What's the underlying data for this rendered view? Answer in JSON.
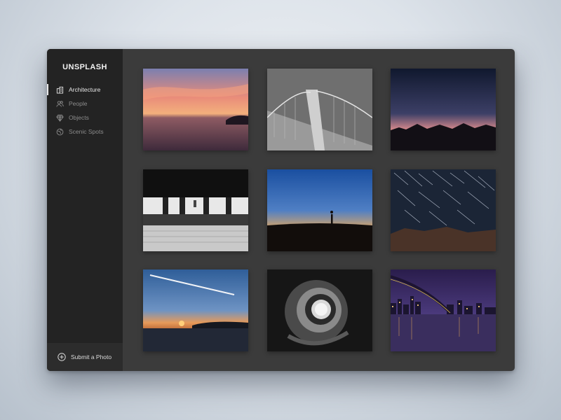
{
  "app": {
    "brand": "UNSPLASH"
  },
  "sidebar": {
    "items": [
      {
        "label": "Architecture",
        "icon": "building-icon",
        "active": true
      },
      {
        "label": "People",
        "icon": "people-icon",
        "active": false
      },
      {
        "label": "Objects",
        "icon": "diamond-icon",
        "active": false
      },
      {
        "label": "Scenic Spots",
        "icon": "globe-icon",
        "active": false
      }
    ],
    "submit_label": "Submit a Photo",
    "submit_icon": "plus-circle-icon"
  },
  "gallery": {
    "photos": [
      "sunset-sea-photo",
      "bridge-tower-photo",
      "mountain-dusk-photo",
      "subway-station-photo",
      "silhouette-horizon-photo",
      "star-trails-photo",
      "contrail-sunset-photo",
      "spiral-staircase-photo",
      "city-bridge-night-photo"
    ]
  },
  "colors": {
    "window": "#3b3b3b",
    "sidebar": "#232323",
    "active_text": "#e6e6e6",
    "inactive_text": "#8c8c8c"
  }
}
